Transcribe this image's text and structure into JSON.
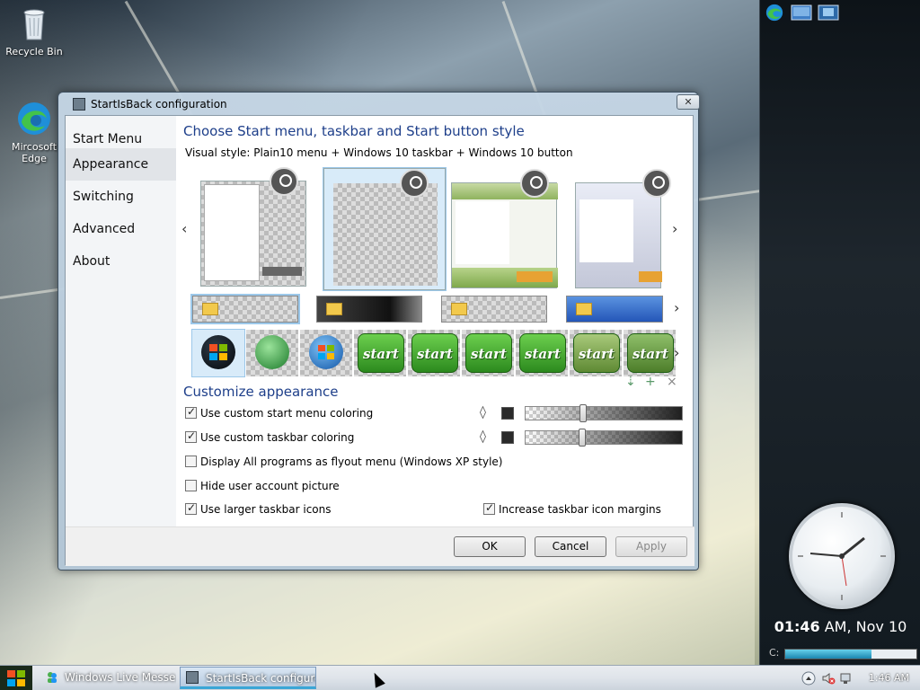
{
  "desktop": {
    "icons": [
      {
        "label": "Recycle Bin"
      },
      {
        "label": "Mircosoft Edge"
      }
    ]
  },
  "dialog": {
    "title": "StartIsBack configuration",
    "close_glyph": "✕",
    "nav": [
      {
        "label": "Start Menu",
        "active": false
      },
      {
        "label": "Appearance",
        "active": true
      },
      {
        "label": "Switching",
        "active": false
      },
      {
        "label": "Advanced",
        "active": false
      },
      {
        "label": "About",
        "active": false
      }
    ],
    "style_section": {
      "title": "Choose Start menu, taskbar and Start button style",
      "visual_style_label": "Visual style:",
      "visual_style_value": "Plain10 menu + Windows 10 taskbar + Windows 10 button",
      "start_button_labels": [
        "start",
        "start",
        "start",
        "start",
        "start",
        "start"
      ]
    },
    "customize": {
      "title": "Customize appearance",
      "options": [
        {
          "label": "Use custom start menu coloring",
          "checked": true
        },
        {
          "label": "Use custom taskbar coloring",
          "checked": true
        },
        {
          "label": "Display All programs as flyout menu (Windows XP style)",
          "checked": false
        },
        {
          "label": "Hide user account picture",
          "checked": false
        },
        {
          "label": "Use larger taskbar icons",
          "checked": true
        },
        {
          "label": "Increase taskbar icon margins",
          "checked": true
        }
      ],
      "slider_levels": [
        0.36,
        0.35
      ]
    },
    "buttons": {
      "ok": "OK",
      "cancel": "Cancel",
      "apply": "Apply"
    }
  },
  "sidebar": {
    "time": "01:46",
    "ampm_date": " AM, Nov 10",
    "cpu_label": "C:",
    "cpu_level": 0.66
  },
  "taskbar": {
    "items": [
      {
        "label": "Windows Live Messe..."
      },
      {
        "label": "StartIsBack configure..."
      }
    ],
    "clock": "1:46 AM"
  }
}
